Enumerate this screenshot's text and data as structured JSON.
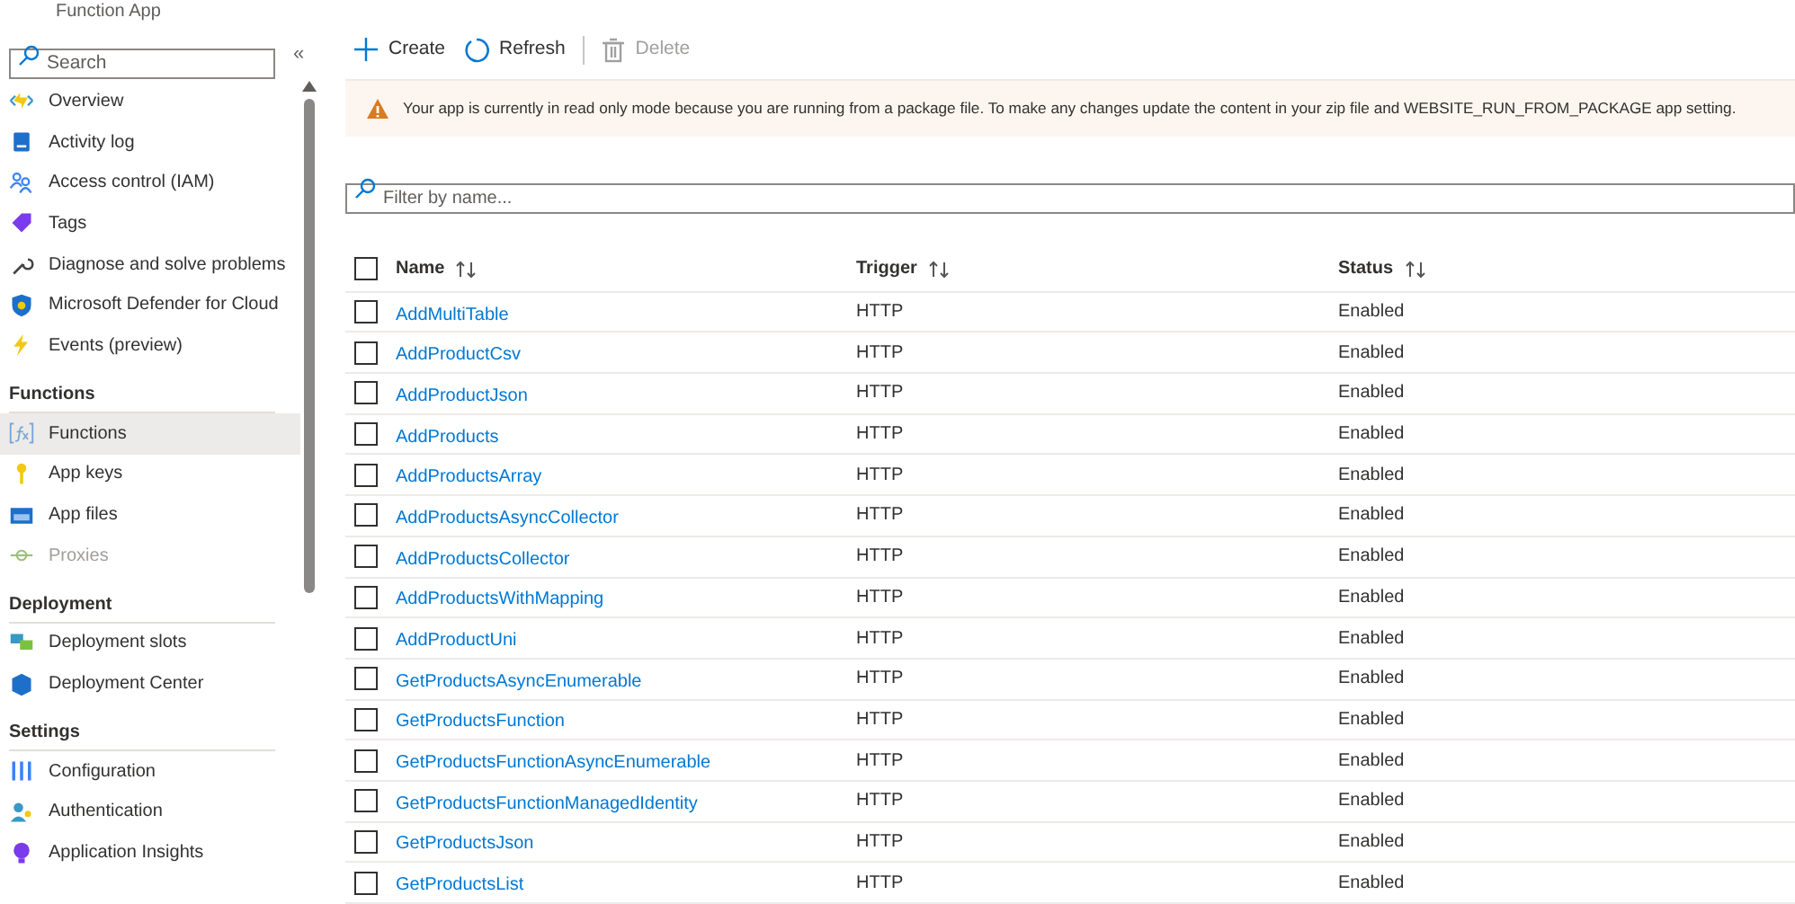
{
  "header": {
    "subtitle": "Function App"
  },
  "sidebar": {
    "search": {
      "placeholder": "Search"
    },
    "collapse": "«",
    "sections": [
      {
        "items": [
          {
            "label": "Overview",
            "selected": false,
            "disabled": false
          },
          {
            "label": "Activity log",
            "selected": false,
            "disabled": false
          },
          {
            "label": "Access control (IAM)",
            "selected": false,
            "disabled": false
          },
          {
            "label": "Tags",
            "selected": false,
            "disabled": false
          },
          {
            "label": "Diagnose and solve problems",
            "selected": false,
            "disabled": false
          },
          {
            "label": "Microsoft Defender for Cloud",
            "selected": false,
            "disabled": false
          },
          {
            "label": "Events (preview)",
            "selected": false,
            "disabled": false
          }
        ]
      },
      {
        "title": "Functions",
        "items": [
          {
            "label": "Functions",
            "selected": true,
            "disabled": false
          },
          {
            "label": "App keys",
            "selected": false,
            "disabled": false
          },
          {
            "label": "App files",
            "selected": false,
            "disabled": false
          },
          {
            "label": "Proxies",
            "selected": false,
            "disabled": true
          }
        ]
      },
      {
        "title": "Deployment",
        "items": [
          {
            "label": "Deployment slots",
            "selected": false,
            "disabled": false
          },
          {
            "label": "Deployment Center",
            "selected": false,
            "disabled": false
          }
        ]
      },
      {
        "title": "Settings",
        "items": [
          {
            "label": "Configuration",
            "selected": false,
            "disabled": false
          },
          {
            "label": "Authentication",
            "selected": false,
            "disabled": false
          },
          {
            "label": "Application Insights",
            "selected": false,
            "disabled": false
          }
        ]
      }
    ]
  },
  "toolbar": [
    {
      "kind": "create",
      "label": "Create",
      "disabled": false
    },
    {
      "kind": "refresh",
      "label": "Refresh",
      "disabled": false
    },
    {
      "kind": "delete",
      "label": "Delete",
      "disabled": true
    }
  ],
  "banner": {
    "text": "Your app is currently in read only mode because you are running from a package file. To make any changes update the content in your zip file and WEBSITE_RUN_FROM_PACKAGE app setting."
  },
  "filter": {
    "placeholder": "Filter by name..."
  },
  "table": {
    "columns": [
      "Name",
      "Trigger",
      "Status"
    ],
    "select_all": false,
    "rows": [
      {
        "name": "AddMultiTable",
        "trigger": "HTTP",
        "status": "Enabled",
        "checked": false
      },
      {
        "name": "AddProductCsv",
        "trigger": "HTTP",
        "status": "Enabled",
        "checked": false
      },
      {
        "name": "AddProductJson",
        "trigger": "HTTP",
        "status": "Enabled",
        "checked": false
      },
      {
        "name": "AddProducts",
        "trigger": "HTTP",
        "status": "Enabled",
        "checked": false
      },
      {
        "name": "AddProductsArray",
        "trigger": "HTTP",
        "status": "Enabled",
        "checked": false
      },
      {
        "name": "AddProductsAsyncCollector",
        "trigger": "HTTP",
        "status": "Enabled",
        "checked": false
      },
      {
        "name": "AddProductsCollector",
        "trigger": "HTTP",
        "status": "Enabled",
        "checked": false
      },
      {
        "name": "AddProductsWithMapping",
        "trigger": "HTTP",
        "status": "Enabled",
        "checked": false
      },
      {
        "name": "AddProductUni",
        "trigger": "HTTP",
        "status": "Enabled",
        "checked": false
      },
      {
        "name": "GetProductsAsyncEnumerable",
        "trigger": "HTTP",
        "status": "Enabled",
        "checked": false
      },
      {
        "name": "GetProductsFunction",
        "trigger": "HTTP",
        "status": "Enabled",
        "checked": false
      },
      {
        "name": "GetProductsFunctionAsyncEnumerable",
        "trigger": "HTTP",
        "status": "Enabled",
        "checked": false
      },
      {
        "name": "GetProductsFunctionManagedIdentity",
        "trigger": "HTTP",
        "status": "Enabled",
        "checked": false
      },
      {
        "name": "GetProductsJson",
        "trigger": "HTTP",
        "status": "Enabled",
        "checked": false
      },
      {
        "name": "GetProductsList",
        "trigger": "HTTP",
        "status": "Enabled",
        "checked": false
      }
    ]
  }
}
